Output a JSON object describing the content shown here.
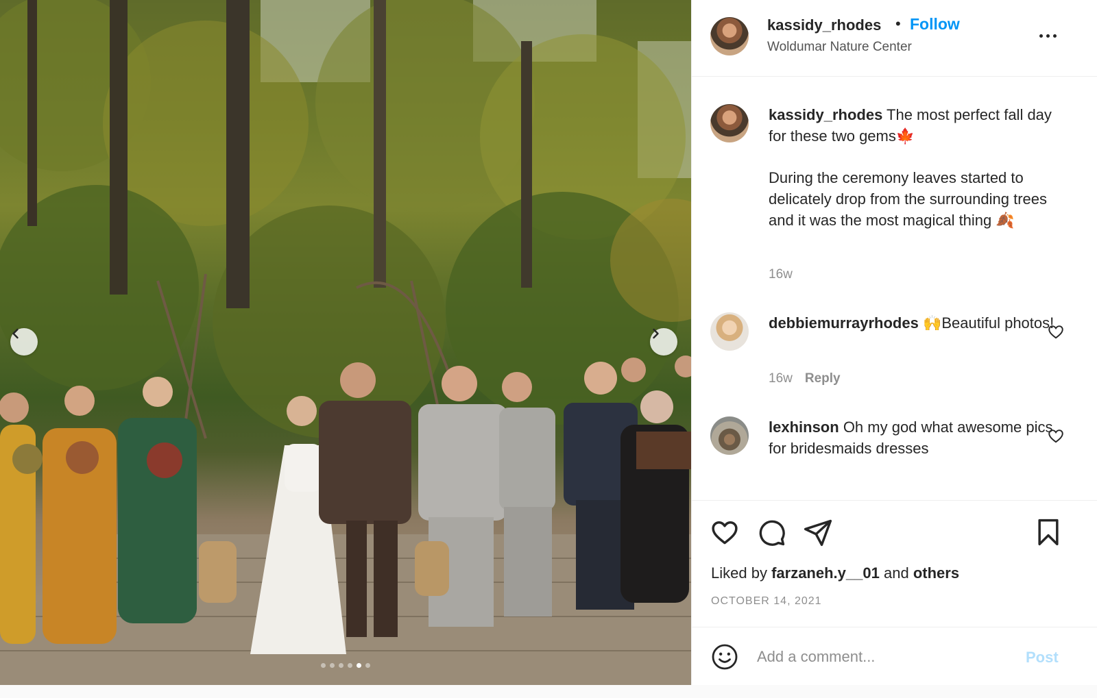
{
  "post": {
    "slide_count": 6,
    "active_slide": 5
  },
  "header": {
    "username": "kassidy_rhodes",
    "separator": "•",
    "follow_label": "Follow",
    "location": "Woldumar Nature Center"
  },
  "caption": {
    "username": "kassidy_rhodes",
    "line1": "The most perfect fall day for these two gems🍁",
    "line2": "During the ceremony leaves started to delicately drop from the surrounding trees and it was the most magical thing 🍂",
    "time": "16w"
  },
  "comments": [
    {
      "username": "debbiemurrayrhodes",
      "text": "🙌Beautiful photos!",
      "time": "16w",
      "reply_label": "Reply"
    },
    {
      "username": "lexhinson",
      "text": "Oh my god what awesome pics for bridesmaids dresses"
    }
  ],
  "likes": {
    "prefix": "Liked by",
    "user": "farzaneh.y__01",
    "conj": "and",
    "others": "others"
  },
  "date": "OCTOBER 14, 2021",
  "add_comment": {
    "placeholder": "Add a comment...",
    "post_label": "Post"
  },
  "colors": {
    "link_blue": "#0095f6",
    "post_disabled": "#b2dffc",
    "secondary_text": "#8e8e8e"
  }
}
